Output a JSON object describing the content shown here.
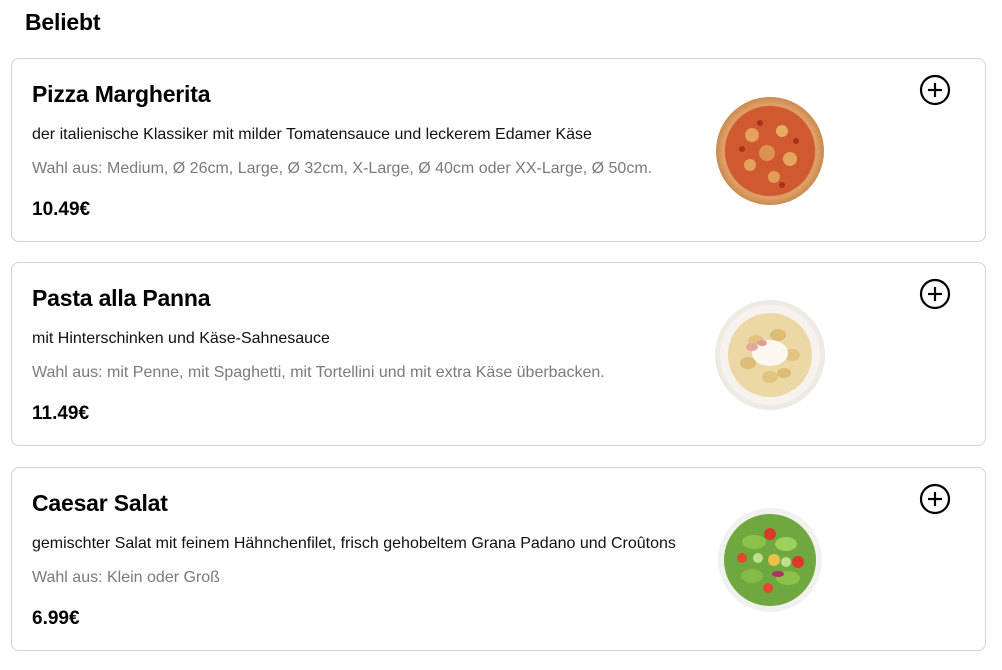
{
  "section": {
    "title": "Beliebt"
  },
  "items": [
    {
      "name": "Pizza Margherita",
      "description": "der italienische Klassiker mit milder Tomatensauce und leckerem Edamer Käse",
      "choice": "Wahl aus: Medium, Ø 26cm, Large, Ø 32cm, X-Large, Ø 40cm oder XX-Large, Ø 50cm.",
      "price": "10.49€",
      "image": "pizza-image",
      "add_icon": "plus-circle-icon"
    },
    {
      "name": "Pasta alla Panna",
      "description": "mit Hinterschinken und Käse-Sahnesauce",
      "choice": "Wahl aus: mit Penne, mit Spaghetti, mit Tortellini und mit extra Käse überbacken.",
      "price": "11.49€",
      "image": "pasta-image",
      "add_icon": "plus-circle-icon"
    },
    {
      "name": "Caesar Salat",
      "description": "gemischter Salat mit feinem Hähnchenfilet, frisch gehobeltem Grana Padano und Croûtons",
      "choice": "Wahl aus: Klein oder Groß",
      "price": "6.99€",
      "image": "salad-image",
      "add_icon": "plus-circle-icon"
    }
  ],
  "colors": {
    "border": "#d4d4d4",
    "secondary_text": "#7a7a7a"
  }
}
